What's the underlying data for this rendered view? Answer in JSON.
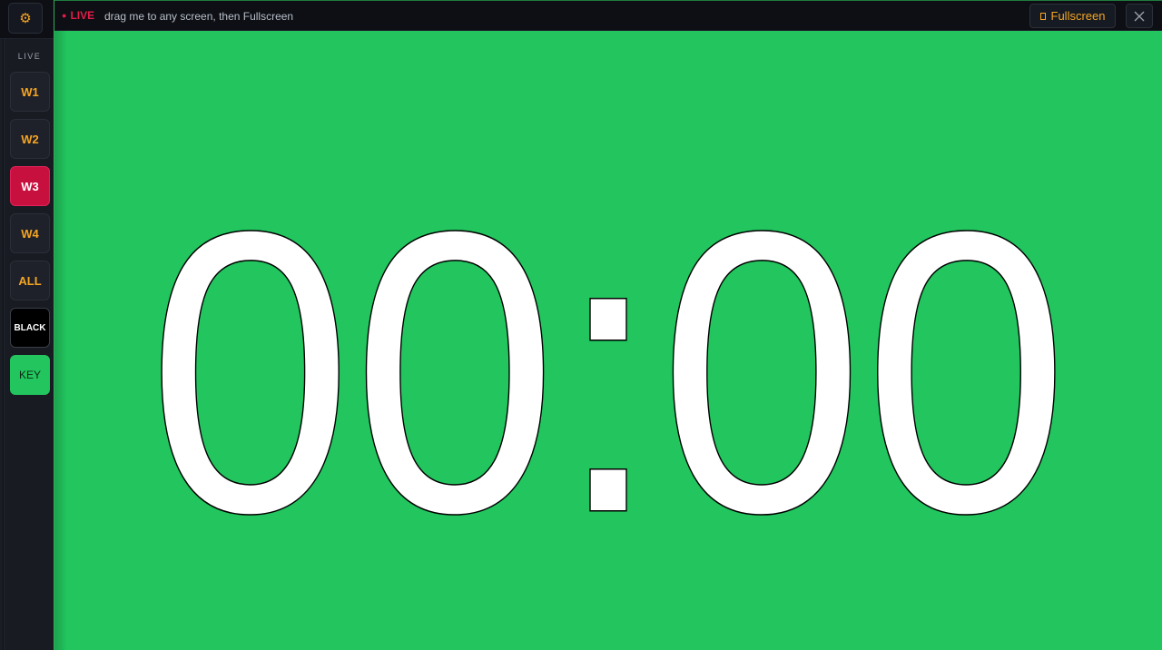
{
  "toolbar": {
    "settings_icon": "gear-icon"
  },
  "sidebar": {
    "heading": "LIVE",
    "buttons": [
      {
        "label": "W1",
        "state": "idle"
      },
      {
        "label": "W2",
        "state": "idle"
      },
      {
        "label": "W3",
        "state": "active"
      },
      {
        "label": "W4",
        "state": "idle"
      },
      {
        "label": "ALL",
        "state": "idle"
      },
      {
        "label": "BLACK",
        "state": "idle"
      },
      {
        "label": "KEY",
        "state": "idle"
      }
    ]
  },
  "live_window": {
    "badge": "LIVE",
    "hint": "drag me to any screen, then Fullscreen",
    "fullscreen_label": "Fullscreen",
    "close_icon": "close-icon",
    "timer": "00:00",
    "background_color": "#22c55e"
  },
  "colors": {
    "accent": "#f5a524",
    "live_red": "#e11d48",
    "active_button": "#c8103f",
    "key_green": "#22c55e"
  }
}
